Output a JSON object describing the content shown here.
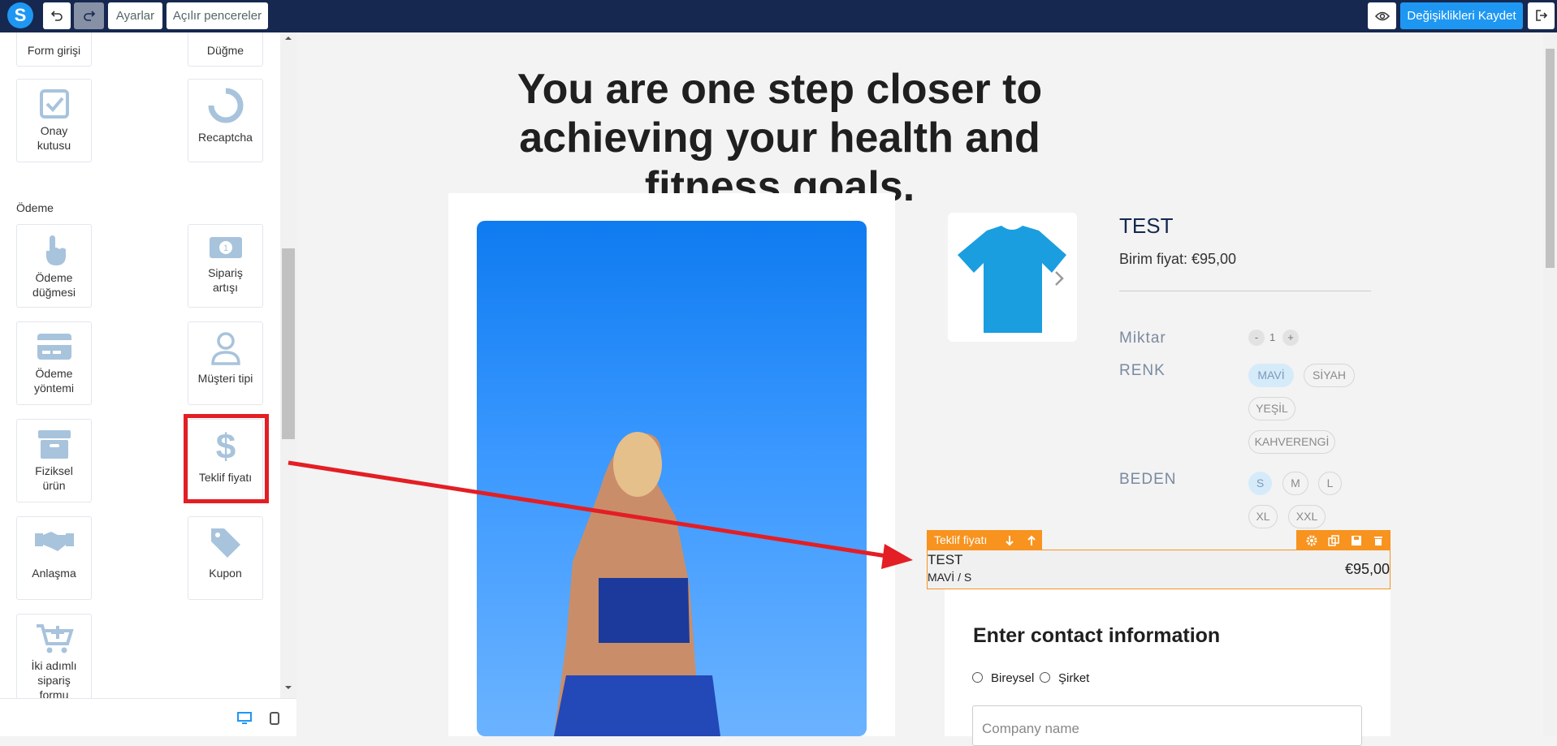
{
  "topbar": {
    "logo": "S",
    "settings_label": "Ayarlar",
    "popups_label": "Açılır pencereler",
    "save_label": "Değişiklikleri Kaydet"
  },
  "sidebar": {
    "items_top": [
      {
        "label": "Form girişi",
        "icon": "form-input-icon"
      },
      {
        "label": "Düğme",
        "icon": "button-icon"
      },
      {
        "label": "Onay kutusu",
        "icon": "checkbox-icon"
      },
      {
        "label": "Recaptcha",
        "icon": "recaptcha-icon"
      }
    ],
    "section": "Ödeme",
    "payment_items": [
      {
        "label": "Ödeme düğmesi",
        "icon": "pointer-hand-icon"
      },
      {
        "label": "Sipariş artışı",
        "icon": "banknote-icon"
      },
      {
        "label": "Ödeme yöntemi",
        "icon": "credit-card-icon"
      },
      {
        "label": "Müşteri tipi",
        "icon": "user-icon"
      },
      {
        "label": "Fiziksel ürün",
        "icon": "archive-box-icon"
      },
      {
        "label": "Teklif fiyatı",
        "icon": "dollar-icon"
      },
      {
        "label": "Anlaşma",
        "icon": "handshake-icon"
      },
      {
        "label": "Kupon",
        "icon": "tags-icon"
      },
      {
        "label": "İki adımlı sipariş formu",
        "icon": "cart-plus-icon"
      }
    ]
  },
  "canvas": {
    "headline": "You are one step closer to achieving your health and fitness goals.",
    "product": {
      "title": "TEST",
      "price": "Birim fiyat: €95,00",
      "quantity_label": "Miktar",
      "quantity": "1",
      "color_label": "RENK",
      "colors": [
        "MAVİ",
        "SİYAH",
        "YEŞİL",
        "KAHVERENGİ"
      ],
      "selected_color": "MAVİ",
      "size_label": "BEDEN",
      "sizes": [
        "S",
        "M",
        "L",
        "XL",
        "XXL"
      ],
      "selected_size": "S"
    },
    "offer": {
      "toolbar_label": "Teklif fiyatı",
      "name": "TEST",
      "variant": "MAVİ / S",
      "price": "€95,00"
    },
    "contact": {
      "title": "Enter contact information",
      "radio_individual": "Bireysel",
      "radio_company": "Şirket",
      "company_placeholder": "Company name"
    }
  },
  "colors": {
    "topbar_bg": "#16284f",
    "accent_blue": "#1e97f3",
    "highlight_red": "#e31e24",
    "element_orange": "#f7931e"
  }
}
